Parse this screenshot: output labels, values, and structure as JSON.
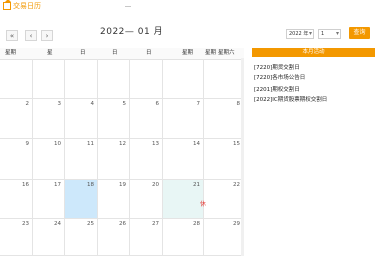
{
  "header": {
    "app_title": "交易日历",
    "home_icon": "home-icon"
  },
  "nav": {
    "first_label": "«",
    "prev_label": "‹",
    "next_label": "›"
  },
  "month_title": "2022— 01 月",
  "selector": {
    "year_value": "2022 年",
    "month_value": "1",
    "query_label": "查询"
  },
  "calendar": {
    "weekdays": [
      "星期",
      "星",
      "日",
      "日",
      "日",
      "星期",
      "星期",
      "星期六"
    ],
    "rows": [
      [
        "",
        "",
        "",
        "",
        "",
        "",
        "",
        ""
      ],
      [
        "2",
        "3",
        "4",
        "5",
        "6",
        "7",
        "",
        "8"
      ],
      [
        "9",
        "10",
        "11",
        "12",
        "13",
        "14",
        "",
        "15"
      ],
      [
        "16",
        "17",
        "18",
        "19",
        "20",
        "21",
        "",
        "22"
      ],
      [
        "23",
        "24",
        "25",
        "26",
        "27",
        "28",
        "",
        "29"
      ]
    ],
    "today": "18",
    "holiday": "21",
    "holiday_mark": "休",
    "today_color": "#cde8fb",
    "holiday_color": "#e8f6f5"
  },
  "sidebar": {
    "header": "本月活动",
    "items": [
      "[7220]期货交割日",
      "[7220]各市场公告日",
      "[2201]期权交割日",
      "[2022]IC期货股票期权交割日"
    ]
  },
  "colors": {
    "accent": "#f39800"
  }
}
